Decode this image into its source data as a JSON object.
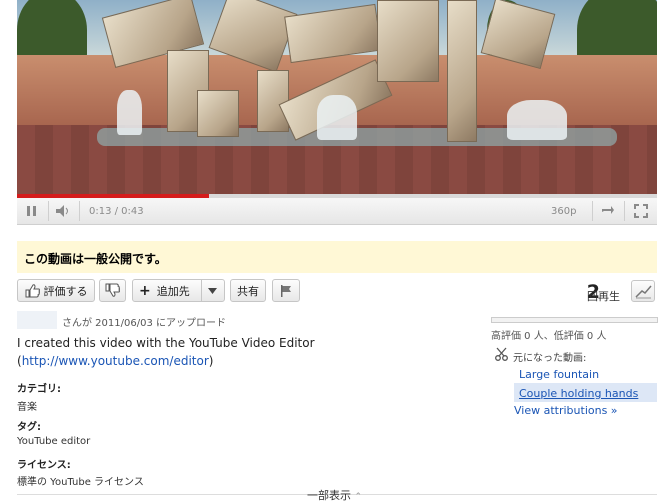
{
  "player": {
    "time": "0:13 / 0:43",
    "progress": 0.3,
    "quality": "360p"
  },
  "privacy": "この動画は一般公開です。",
  "actions": {
    "like": "評価する",
    "add_to": "追加先",
    "share": "共有"
  },
  "views": {
    "count": "2",
    "label": "回再生"
  },
  "uploader": {
    "info": "さんが 2011/06/03 にアップロード"
  },
  "description": {
    "line1": "I created this video with the YouTube Video Editor",
    "open": "(",
    "link": "http://www.youtube.com/editor",
    "close": ")"
  },
  "meta": {
    "category_label": "カテゴリ:",
    "category_value": "音楽",
    "tags_label": "タグ:",
    "tags_value": "YouTube editor",
    "license_label": "ライセンス:",
    "license_value": "標準の YouTube ライセンス"
  },
  "ratings": {
    "text": "高評価 0 人、低評価 0 人"
  },
  "sources": {
    "label": "元になった動画:",
    "items": [
      "Large fountain",
      "Couple holding hands"
    ],
    "view_attributions": "View attributions »"
  },
  "show_more": "一部表示"
}
